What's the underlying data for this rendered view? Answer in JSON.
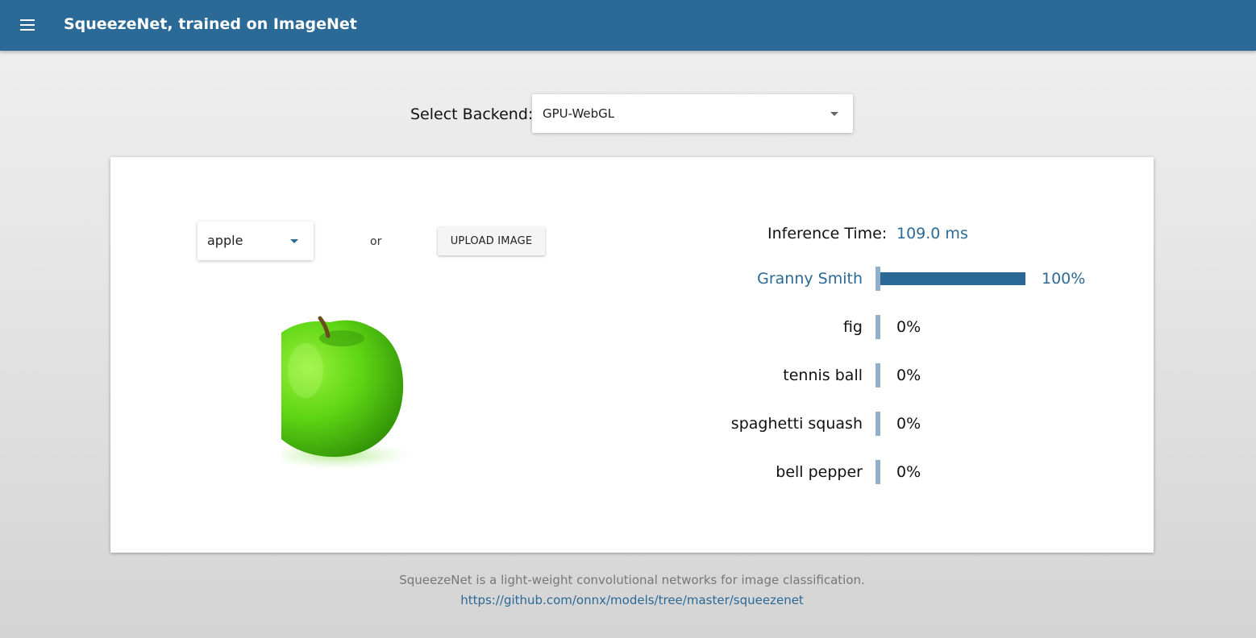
{
  "app": {
    "title": "SqueezeNet, trained on ImageNet",
    "menu_icon": "hamburger-menu-icon",
    "accent_color": "#2b6996"
  },
  "backend": {
    "label": "Select Backend:",
    "selected": "GPU-WebGL"
  },
  "input": {
    "image_selected": "apple",
    "or_text": "or",
    "upload_label": "UPLOAD IMAGE"
  },
  "results": {
    "inference_label": "Inference Time:",
    "inference_value": "109.0 ms",
    "predictions": [
      {
        "label": "Granny Smith",
        "percent_text": "100%",
        "probability": 1.0
      },
      {
        "label": "fig",
        "percent_text": "0%",
        "probability": 0.0
      },
      {
        "label": "tennis ball",
        "percent_text": "0%",
        "probability": 0.0
      },
      {
        "label": "spaghetti squash",
        "percent_text": "0%",
        "probability": 0.0
      },
      {
        "label": "bell pepper",
        "percent_text": "0%",
        "probability": 0.0
      }
    ]
  },
  "footer": {
    "description": "SqueezeNet is a light-weight convolutional networks for image classification.",
    "link": "https://github.com/onnx/models/tree/master/squeezenet"
  }
}
